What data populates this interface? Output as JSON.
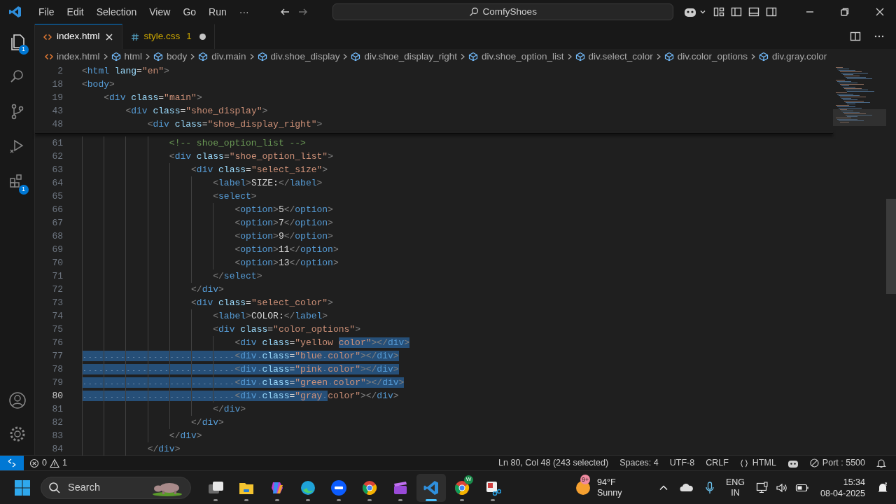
{
  "title_bar": {
    "menu": [
      {
        "label": "File"
      },
      {
        "label": "Edit"
      },
      {
        "label": "Selection"
      },
      {
        "label": "View"
      },
      {
        "label": "Go"
      },
      {
        "label": "Run"
      },
      {
        "label": "···"
      }
    ],
    "search": "ComfyShoes"
  },
  "activity_bar": [
    {
      "kind": "files",
      "badge": "1",
      "selected": true
    },
    {
      "kind": "search",
      "selected": false
    },
    {
      "kind": "source-control",
      "selected": false
    },
    {
      "kind": "run",
      "selected": false
    },
    {
      "kind": "extensions",
      "badge": "1",
      "selected": false
    }
  ],
  "tabs": [
    {
      "label": "index.html",
      "kind": "html",
      "selected": true,
      "modified": false
    },
    {
      "label": "style.css",
      "kind": "css",
      "problems": "1",
      "selected": false,
      "modified": true
    }
  ],
  "breadcrumbs": [
    {
      "label": "index.html",
      "kind": "file"
    },
    {
      "label": "html",
      "kind": "element"
    },
    {
      "label": "body",
      "kind": "element"
    },
    {
      "label": "div.main",
      "kind": "element"
    },
    {
      "label": "div.shoe_display",
      "kind": "element"
    },
    {
      "label": "div.shoe_display_right",
      "kind": "element"
    },
    {
      "label": "div.shoe_option_list",
      "kind": "element"
    },
    {
      "label": "div.select_color",
      "kind": "element"
    },
    {
      "label": "div.color_options",
      "kind": "element"
    },
    {
      "label": "div.gray.color",
      "kind": "element"
    }
  ],
  "editor": {
    "sticky_lines": [
      {
        "number": "2",
        "text": "<html lang=\"en\">"
      },
      {
        "number": "18",
        "text": "<body>"
      },
      {
        "number": "19",
        "text": "    <div class=\"main\">"
      },
      {
        "number": "43",
        "text": "        <div class=\"shoe_display\">"
      },
      {
        "number": "48",
        "text": "            <div class=\"shoe_display_right\">"
      }
    ],
    "lines": [
      {
        "number": "61",
        "current": false,
        "segments": [
          {
            "text": "                <!-- shoe_option_list -->",
            "selected": false
          }
        ]
      },
      {
        "number": "62",
        "current": false,
        "segments": [
          {
            "text": "                <div class=\"shoe_option_list\">",
            "selected": false
          }
        ]
      },
      {
        "number": "63",
        "current": false,
        "segments": [
          {
            "text": "                    <div class=\"select_size\">",
            "selected": false
          }
        ]
      },
      {
        "number": "64",
        "current": false,
        "segments": [
          {
            "text": "                        <label>SIZE:</label>",
            "selected": false
          }
        ]
      },
      {
        "number": "65",
        "current": false,
        "segments": [
          {
            "text": "                        <select>",
            "selected": false
          }
        ]
      },
      {
        "number": "66",
        "current": false,
        "segments": [
          {
            "text": "                            <option>5</option>",
            "selected": false
          }
        ]
      },
      {
        "number": "67",
        "current": false,
        "segments": [
          {
            "text": "                            <option>7</option>",
            "selected": false
          }
        ]
      },
      {
        "number": "68",
        "current": false,
        "segments": [
          {
            "text": "                            <option>9</option>",
            "selected": false
          }
        ]
      },
      {
        "number": "69",
        "current": false,
        "segments": [
          {
            "text": "                            <option>11</option>",
            "selected": false
          }
        ]
      },
      {
        "number": "70",
        "current": false,
        "segments": [
          {
            "text": "                            <option>13</option>",
            "selected": false
          }
        ]
      },
      {
        "number": "71",
        "current": false,
        "segments": [
          {
            "text": "                        </select>",
            "selected": false
          }
        ]
      },
      {
        "number": "72",
        "current": false,
        "segments": [
          {
            "text": "                    </div>",
            "selected": false
          }
        ]
      },
      {
        "number": "73",
        "current": false,
        "segments": [
          {
            "text": "                    <div class=\"select_color\">",
            "selected": false
          }
        ]
      },
      {
        "number": "74",
        "current": false,
        "segments": [
          {
            "text": "                        <label>COLOR:</label>",
            "selected": false
          }
        ]
      },
      {
        "number": "75",
        "current": false,
        "segments": [
          {
            "text": "                        <div class=\"color_options\">",
            "selected": false
          }
        ]
      },
      {
        "number": "76",
        "current": false,
        "segments": [
          {
            "text": "                            <div class=\"yellow ",
            "selected": false
          },
          {
            "text": "color\"></div>",
            "selected": true
          }
        ]
      },
      {
        "number": "77",
        "current": false,
        "segments": [
          {
            "text": "                            <div class=\"blue color\"></div>",
            "selected": true
          }
        ]
      },
      {
        "number": "78",
        "current": false,
        "segments": [
          {
            "text": "                            <div class=\"pink color\"></div>",
            "selected": true
          }
        ]
      },
      {
        "number": "79",
        "current": false,
        "segments": [
          {
            "text": "                            <div class=\"green color\"></div>",
            "selected": true
          }
        ]
      },
      {
        "number": "80",
        "current": true,
        "segments": [
          {
            "text": "                            <div class=\"gray ",
            "selected": true
          },
          {
            "text": "color\"></div>",
            "selected": false
          }
        ]
      },
      {
        "number": "81",
        "current": false,
        "segments": [
          {
            "text": "                        </div>",
            "selected": false
          }
        ]
      },
      {
        "number": "82",
        "current": false,
        "segments": [
          {
            "text": "                    </div>",
            "selected": false
          }
        ]
      },
      {
        "number": "83",
        "current": false,
        "segments": [
          {
            "text": "                </div>",
            "selected": false
          }
        ]
      },
      {
        "number": "84",
        "current": false,
        "segments": [
          {
            "text": "            </div>",
            "selected": false
          }
        ]
      }
    ]
  },
  "status_bar": {
    "errors": "0",
    "warnings": "1",
    "position": "Ln 80, Col 48 (243 selected)",
    "spaces": "Spaces: 4",
    "encoding": "UTF-8",
    "eol": "CRLF",
    "language": "HTML",
    "port": "Port : 5500"
  },
  "taskbar": {
    "search": "Search",
    "apps": [
      {
        "kind": "task-view",
        "selected": false
      },
      {
        "kind": "folder",
        "selected": false
      },
      {
        "kind": "copilot",
        "selected": false
      },
      {
        "kind": "edge",
        "selected": false
      },
      {
        "kind": "zoom",
        "selected": false
      },
      {
        "kind": "chrome",
        "selected": false
      },
      {
        "kind": "clipchamp",
        "selected": false
      },
      {
        "kind": "vscode",
        "selected": true
      },
      {
        "kind": "chrome",
        "badge": "W",
        "selected": false
      },
      {
        "kind": "snipping",
        "selected": false
      }
    ],
    "weather": {
      "badge": "9+",
      "temperature": "94°F",
      "condition": "Sunny"
    },
    "language": "ENG",
    "region": "IN",
    "time": "15:34",
    "date": "08-04-2025"
  }
}
